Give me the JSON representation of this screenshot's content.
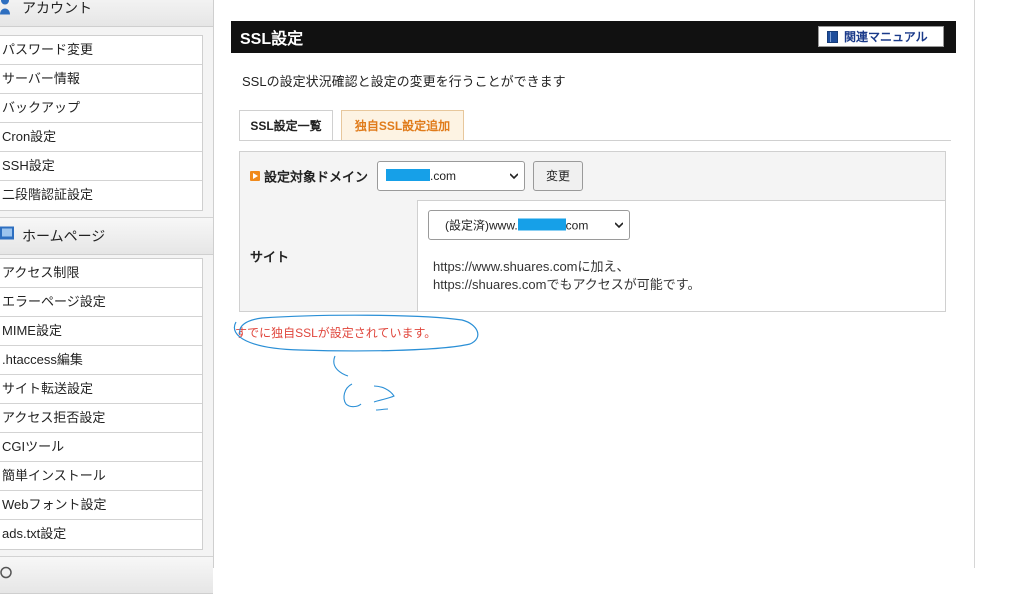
{
  "sidebar": {
    "sections": [
      {
        "icon": "person-icon",
        "title": "アカウント",
        "items": [
          "パスワード変更",
          "サーバー情報",
          "バックアップ",
          "Cron設定",
          "SSH設定",
          "二段階認証設定"
        ]
      },
      {
        "icon": "monitor-icon",
        "title": "ホームページ",
        "items": [
          "アクセス制限",
          "エラーページ設定",
          "MIME設定",
          ".htaccess編集",
          "サイト転送設定",
          "アクセス拒否設定",
          "CGIツール",
          "簡単インストール",
          "Webフォント設定",
          "ads.txt設定"
        ]
      }
    ]
  },
  "main": {
    "title": "SSL設定",
    "manual_button": "関連マニュアル",
    "description": "SSLの設定状況確認と設定の変更を行うことができます",
    "tabs": [
      {
        "label": "SSL設定一覧",
        "active": false
      },
      {
        "label": "独自SSL設定追加",
        "active": true
      }
    ],
    "domain_label": "設定対象ドメイン",
    "domain_select": {
      "suffix": ".com"
    },
    "change_button": "変更",
    "site_label": "サイト",
    "site_select": {
      "prefix": "(設定済)www.",
      "suffix": "com"
    },
    "site_note_1": "https://www.shuares.comに加え、",
    "site_note_2": "https://shuares.comでもアクセスが可能です。",
    "error_message": "すでに独自SSLが設定されています。"
  },
  "colors": {
    "titlebar": "#111111",
    "active_tab_text": "#e07b1a",
    "error_text": "#e0463c",
    "mask": "#16a0e8",
    "annotation": "#2a8fd6"
  }
}
